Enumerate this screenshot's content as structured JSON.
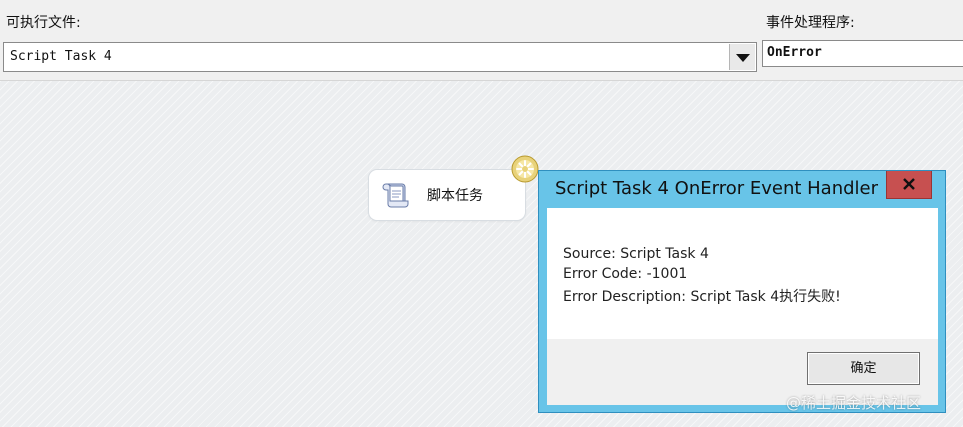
{
  "toolbar": {
    "executable_label": "可执行文件:",
    "executable_value": "Script Task 4",
    "handler_label": "事件处理程序:",
    "handler_value": "OnError"
  },
  "task_node": {
    "label": "脚本任务",
    "icon": "scroll-icon",
    "badge_icon": "error-gear-icon"
  },
  "dialog": {
    "title": "Script Task 4 OnError Event Handler",
    "close_icon": "close-icon",
    "lines": [
      "Source: Script Task 4",
      "Error Code: -1001",
      "Error Description: Script Task 4执行失败!"
    ],
    "ok_label": "确定"
  },
  "watermark": "@稀土掘金技术社区",
  "colors": {
    "dialog_frame": "#68c4e8",
    "close_button": "#c75050"
  }
}
